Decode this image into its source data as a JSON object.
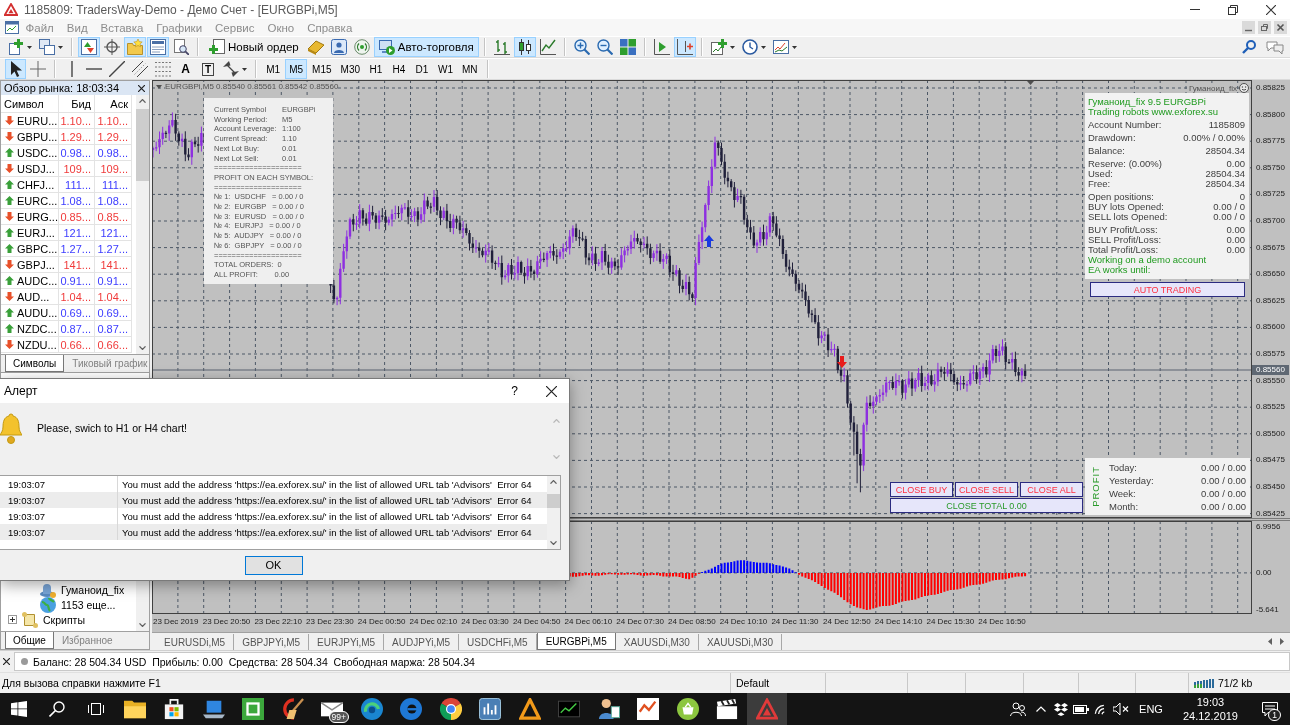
{
  "window": {
    "title": "1185809: TradersWay-Demo - Демо Счет - [EURGBPi,M5]"
  },
  "menu": [
    {
      "label": "Файл",
      "disabled": true
    },
    {
      "label": "Вид",
      "disabled": true
    },
    {
      "label": "Вставка",
      "disabled": true
    },
    {
      "label": "Графики",
      "disabled": true
    },
    {
      "label": "Сервис",
      "disabled": true
    },
    {
      "label": "Окно",
      "disabled": true
    },
    {
      "label": "Справка",
      "disabled": true
    }
  ],
  "toolbar": [
    {
      "kind": "newchart",
      "dropdown": true,
      "on": false
    },
    {
      "kind": "profiles",
      "dropdown": true,
      "on": false
    },
    {
      "kind": "separator"
    },
    {
      "kind": "marketwatch",
      "on": true
    },
    {
      "kind": "datawindow",
      "on": false
    },
    {
      "kind": "navigator",
      "on": true
    },
    {
      "kind": "terminal",
      "on": true
    },
    {
      "kind": "tester",
      "on": false
    },
    {
      "kind": "separator"
    },
    {
      "kind": "neworder",
      "label": "Новый ордер",
      "on": false
    },
    {
      "kind": "editor",
      "on": false
    },
    {
      "kind": "signals",
      "on": false
    },
    {
      "kind": "radio",
      "on": false
    },
    {
      "kind": "autotrading",
      "label": "Авто-торговля",
      "on": true
    },
    {
      "kind": "separator"
    },
    {
      "kind": "bars",
      "on": false
    },
    {
      "kind": "candles",
      "on": true
    },
    {
      "kind": "line",
      "on": false
    },
    {
      "kind": "separator"
    },
    {
      "kind": "zoomin",
      "on": false
    },
    {
      "kind": "zoomout",
      "on": false
    },
    {
      "kind": "tile",
      "on": false
    },
    {
      "kind": "separator"
    },
    {
      "kind": "autoscroll",
      "on": false
    },
    {
      "kind": "chartshift",
      "on": true
    },
    {
      "kind": "separator"
    },
    {
      "kind": "indicators",
      "dropdown": true,
      "on": false
    },
    {
      "kind": "periods",
      "dropdown": true,
      "on": false
    },
    {
      "kind": "templates",
      "dropdown": true,
      "on": false
    }
  ],
  "drawing_toolbar": [
    {
      "kind": "cursor",
      "on": true
    },
    {
      "kind": "crosshair",
      "on": false
    },
    {
      "kind": "separator"
    },
    {
      "kind": "vline",
      "on": false
    },
    {
      "kind": "hline",
      "on": false
    },
    {
      "kind": "trendline",
      "on": false
    },
    {
      "kind": "channel",
      "on": false
    },
    {
      "kind": "fibo",
      "on": false
    },
    {
      "kind": "text",
      "label": "A",
      "on": false
    },
    {
      "kind": "label",
      "label": "T",
      "on": false
    },
    {
      "kind": "shapes",
      "dropdown": true,
      "on": false
    },
    {
      "kind": "separator"
    }
  ],
  "timeframes": [
    {
      "label": "M1",
      "selected": false
    },
    {
      "label": "M5",
      "selected": true
    },
    {
      "label": "M15",
      "selected": false
    },
    {
      "label": "M30",
      "selected": false
    },
    {
      "label": "H1",
      "selected": false
    },
    {
      "label": "H4",
      "selected": false
    },
    {
      "label": "D1",
      "selected": false
    },
    {
      "label": "W1",
      "selected": false
    },
    {
      "label": "MN",
      "selected": false
    }
  ],
  "market_watch": {
    "title": "Обзор рынка: 18:03:34",
    "columns": [
      "Символ",
      "Бид",
      "Аск"
    ],
    "rows": [
      {
        "symbol": "EURU...",
        "bid": "1.10...",
        "ask": "1.10...",
        "rising": false
      },
      {
        "symbol": "GBPU...",
        "bid": "1.29...",
        "ask": "1.29...",
        "rising": false
      },
      {
        "symbol": "USDC...",
        "bid": "0.98...",
        "ask": "0.98...",
        "rising": true
      },
      {
        "symbol": "USDJ...",
        "bid": "109...",
        "ask": "109...",
        "rising": false
      },
      {
        "symbol": "CHFJ...",
        "bid": "111...",
        "ask": "111...",
        "rising": true
      },
      {
        "symbol": "EURC...",
        "bid": "1.08...",
        "ask": "1.08...",
        "rising": true
      },
      {
        "symbol": "EURG...",
        "bid": "0.85...",
        "ask": "0.85...",
        "rising": false
      },
      {
        "symbol": "EURJ...",
        "bid": "121...",
        "ask": "121...",
        "rising": true
      },
      {
        "symbol": "GBPC...",
        "bid": "1.27...",
        "ask": "1.27...",
        "rising": true
      },
      {
        "symbol": "GBPJ...",
        "bid": "141...",
        "ask": "141...",
        "rising": false
      },
      {
        "symbol": "AUDC...",
        "bid": "0.91...",
        "ask": "0.91...",
        "rising": true
      },
      {
        "symbol": "AUD...",
        "bid": "1.04...",
        "ask": "1.04...",
        "rising": false
      },
      {
        "symbol": "AUDU...",
        "bid": "0.69...",
        "ask": "0.69...",
        "rising": true
      },
      {
        "symbol": "NZDC...",
        "bid": "0.87...",
        "ask": "0.87...",
        "rising": true
      },
      {
        "symbol": "NZDU...",
        "bid": "0.66...",
        "ask": "0.66...",
        "rising": false
      }
    ],
    "tabs": [
      {
        "label": "Символы",
        "selected": true
      },
      {
        "label": "Тиковый график",
        "selected": false
      }
    ]
  },
  "navigator": {
    "tree": [
      {
        "children": [
          {
            "label": "Гуманоид_fix",
            "kind": "expert"
          },
          {
            "label": "1153 еще...",
            "kind": "more"
          }
        ]
      },
      {
        "label": "Скрипты",
        "kind": "scripts",
        "expanded": false
      }
    ],
    "tabs": [
      {
        "label": "Общие",
        "selected": true
      },
      {
        "label": "Избранное",
        "selected": false
      }
    ]
  },
  "chart": {
    "legend": "EURGBPi,M5 0.85540 0.85561 0.85542 0.85560",
    "expert": "Гуманоид_fix",
    "price_labels": [
      "0.85825",
      "0.85800",
      "0.85775",
      "0.85750",
      "0.85725",
      "0.85700",
      "0.85675",
      "0.85650",
      "0.85625",
      "0.85600",
      "0.85575",
      "0.85550",
      "0.85525",
      "0.85500",
      "0.85475",
      "0.85450",
      "0.85425"
    ],
    "current_price": "0.85560",
    "indicator_labels": [
      "6.9956",
      "0.00",
      "-5.641"
    ],
    "time_labels": [
      "23 Dec 2019",
      "23 Dec 20:50",
      "23 Dec 22:10",
      "23 Dec 23:30",
      "24 Dec 00:50",
      "24 Dec 02:10",
      "24 Dec 03:30",
      "24 Dec 04:50",
      "24 Dec 06:10",
      "24 Dec 07:30",
      "24 Dec 08:50",
      "24 Dec 10:10",
      "24 Dec 11:30",
      "24 Dec 12:50",
      "24 Dec 14:10",
      "24 Dec 15:30",
      "24 Dec 16:50"
    ],
    "symbol_panel": [
      {
        "kind": "pair",
        "label": "Current Symbol",
        "value": "EURGBPi"
      },
      {
        "kind": "pair",
        "label": "Working Period:",
        "value": "M5"
      },
      {
        "kind": "pair",
        "label": "Account Leverage:",
        "value": "1:100"
      },
      {
        "kind": "pair",
        "label": "Current Spread:",
        "value": "1.10"
      },
      {
        "kind": "pair",
        "label": "Next Lot Buy:",
        "value": "0.01"
      },
      {
        "kind": "pair",
        "label": "Next Lot Sell:",
        "value": "0.01"
      },
      {
        "kind": "text",
        "text": "===================="
      },
      {
        "kind": "text",
        "text": "PROFIT ON EACH SYMBOL:"
      },
      {
        "kind": "text",
        "text": "===================="
      },
      {
        "kind": "text",
        "text": "№ 1:  USDCHF   = 0.00 / 0"
      },
      {
        "kind": "text",
        "text": "№ 2:  EURGBP   = 0.00 / 0"
      },
      {
        "kind": "text",
        "text": "№ 3:  EURUSD   = 0.00 / 0"
      },
      {
        "kind": "text",
        "text": "№ 4:  EURJPJ   = 0.00 / 0"
      },
      {
        "kind": "text",
        "text": "№ 5:  AUDJPY   = 0.00 / 0"
      },
      {
        "kind": "text",
        "text": "№ 6:  GBPJPY   = 0.00 / 0"
      },
      {
        "kind": "text",
        "text": "===================="
      },
      {
        "kind": "text",
        "text": "TOTAL ORDERS:  0"
      },
      {
        "kind": "text",
        "text": "ALL PROFIT:        0.00"
      }
    ],
    "account_panel": [
      [
        {
          "kind": "note",
          "text": "Гуманоид_fix 9.5 EURGBPi"
        },
        {
          "kind": "note",
          "text": "Trading robots www.exforex.su"
        }
      ],
      [
        {
          "kind": "pair",
          "label": "Account Number:",
          "value": "1185809"
        }
      ],
      [
        {
          "kind": "pair",
          "label": "Drawdown:",
          "value": "0.00% / 0.00%"
        }
      ],
      [
        {
          "kind": "pair",
          "label": "Balance:",
          "value": "28504.34"
        }
      ],
      [
        {
          "kind": "pair",
          "label": "Reserve: (0.00%)",
          "value": "0.00"
        },
        {
          "kind": "pair",
          "label": "Used:",
          "value": "28504.34"
        },
        {
          "kind": "pair",
          "label": "Free:",
          "value": "28504.34"
        }
      ],
      [
        {
          "kind": "pair",
          "label": "Open positions:",
          "value": "0"
        },
        {
          "kind": "pair",
          "label": "BUY lots Opened:",
          "value": "0.00 / 0"
        },
        {
          "kind": "pair",
          "label": "SELL lots Opened:",
          "value": "0.00 / 0"
        }
      ],
      [
        {
          "kind": "pair",
          "label": "BUY Profit/Loss:",
          "value": "0.00"
        },
        {
          "kind": "pair",
          "label": "SELL Profit/Loss:",
          "value": "0.00"
        },
        {
          "kind": "pair",
          "label": "Total Profit/Loss:",
          "value": "0.00"
        },
        {
          "kind": "note",
          "text": "Working on a demo account"
        },
        {
          "kind": "note",
          "text": "EA works until:"
        }
      ]
    ],
    "auto_trading": "AUTO TRADING",
    "close_buttons": [
      "CLOSE BUY",
      "CLOSE SELL",
      "CLOSE ALL"
    ],
    "close_total": "CLOSE TOTAL 0.00",
    "profit_panel": {
      "title": "PROFIT",
      "rows": [
        {
          "label": "Today:",
          "value": "0.00 / 0.00"
        },
        {
          "label": "Yesterday:",
          "value": "0.00 / 0.00"
        },
        {
          "label": "Week:",
          "value": "0.00 / 0.00"
        },
        {
          "label": "Month:",
          "value": "0.00 / 0.00"
        }
      ]
    }
  },
  "chart_tabs": [
    {
      "label": "EURUSDi,M5",
      "selected": false
    },
    {
      "label": "GBPJPYi,M5",
      "selected": false
    },
    {
      "label": "EURJPYi,M5",
      "selected": false
    },
    {
      "label": "AUDJPYi,M5",
      "selected": false
    },
    {
      "label": "USDCHFi,M5",
      "selected": false
    },
    {
      "label": "EURGBPi,M5",
      "selected": true
    },
    {
      "label": "XAUUSDi,M30",
      "selected": false
    },
    {
      "label": "XAUUSDi,M30",
      "selected": false
    }
  ],
  "terminal": {
    "summary": "Баланс: 28 504.34 USD  Прибыль: 0.00  Средства: 28 504.34  Свободная маржа: 28 504.34"
  },
  "status_bar": {
    "help": "Для вызова справки нажмите F1",
    "profile": "Default",
    "traffic": "71/2 kb"
  },
  "alert": {
    "title": "Алерт",
    "help": "?",
    "message": "Please, swich to H1 or H4 chart!",
    "log": [
      {
        "time": "19:03:07",
        "text": "You must add the address 'https://ea.exforex.su/' in the list of allowed URL tab 'Advisors'  Error 64"
      },
      {
        "time": "19:03:07",
        "text": "You must add the address 'https://ea.exforex.su/' in the list of allowed URL tab 'Advisors'  Error 64"
      },
      {
        "time": "19:03:07",
        "text": "You must add the address 'https://ea.exforex.su/' in the list of allowed URL tab 'Advisors'  Error 64"
      },
      {
        "time": "19:03:07",
        "text": "You must add the address 'https://ea.exforex.su/' in the list of allowed URL tab 'Advisors'  Error 64"
      }
    ],
    "button": "OK"
  },
  "taskbar": {
    "apps": [
      {
        "kind": "folder",
        "selected": false
      },
      {
        "kind": "bag",
        "selected": false
      },
      {
        "kind": "laptop",
        "selected": false
      },
      {
        "kind": "tile",
        "selected": false
      },
      {
        "kind": "broom",
        "selected": false
      },
      {
        "kind": "mail",
        "selected": false,
        "badge": "99+"
      },
      {
        "kind": "swirl",
        "selected": false
      },
      {
        "kind": "browser",
        "selected": false
      },
      {
        "kind": "wheel",
        "selected": false
      },
      {
        "kind": "app",
        "selected": false
      },
      {
        "kind": "peak",
        "selected": false
      },
      {
        "kind": "dark",
        "selected": false
      },
      {
        "kind": "person",
        "selected": false
      },
      {
        "kind": "logo",
        "selected": false
      },
      {
        "kind": "basket",
        "selected": false
      },
      {
        "kind": "clapper",
        "selected": false
      },
      {
        "kind": "triangle",
        "selected": true
      }
    ],
    "language": "ENG",
    "time": "19:03",
    "date": "24.12.2019",
    "notifications": "1"
  }
}
